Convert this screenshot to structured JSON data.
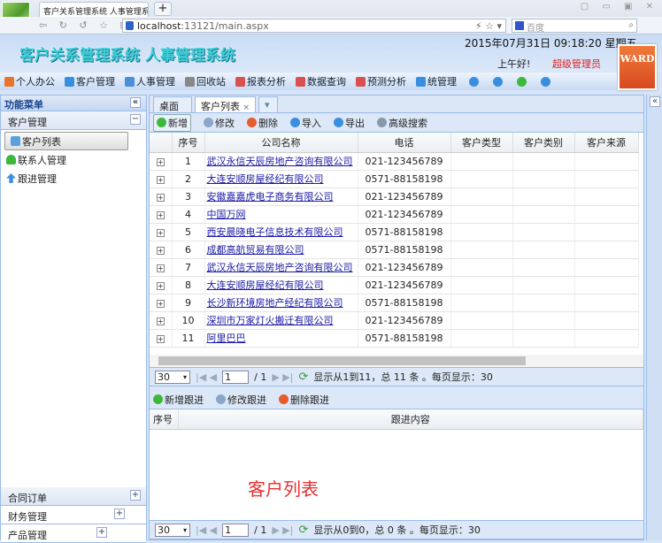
{
  "browser": {
    "tab_title": "客户关系管理系统 人事管理系统",
    "new_tab": "+",
    "url_host": "localhost",
    "url_rest": ":13121/main.aspx",
    "search_placeholder": "百度",
    "window_controls": "▢ ▭ ▣ ✕"
  },
  "header": {
    "title": "客户关系管理系统 人事管理系统",
    "datetime": "2015年07月31日 09:18:20 星期五",
    "greeting": "上午好!",
    "role": "超级管理员",
    "logo_text": "WARD"
  },
  "menu": [
    {
      "label": "个人办公",
      "icon": "home-icon",
      "color": "#e8742a"
    },
    {
      "label": "客户管理",
      "icon": "card-icon",
      "color": "#3a8ee0"
    },
    {
      "label": "人事管理",
      "icon": "user-icon",
      "color": "#4a90d9"
    },
    {
      "label": "回收站",
      "icon": "recycle-icon",
      "color": "#888888"
    },
    {
      "label": "报表分析",
      "icon": "chart-icon",
      "color": "#d85050"
    },
    {
      "label": "数据查询",
      "icon": "chart-icon",
      "color": "#d85050"
    },
    {
      "label": "预测分析",
      "icon": "chart-icon",
      "color": "#d85050"
    },
    {
      "label": "统管理",
      "icon": "gear-icon",
      "color": "#3a8ee0"
    }
  ],
  "sidebar": {
    "title": "功能菜单",
    "collapse": "«",
    "sections": [
      {
        "label": "客户管理",
        "toggle": "−"
      },
      {
        "label": "合同订单",
        "toggle": "+"
      },
      {
        "label": "财务管理",
        "toggle": "+"
      },
      {
        "label": "产品管理",
        "toggle": "+"
      }
    ],
    "items": [
      {
        "label": "客户列表",
        "icon": "home-icon"
      },
      {
        "label": "联系人管理",
        "icon": "contact-icon"
      },
      {
        "label": "跟进管理",
        "icon": "arrow-up-icon"
      }
    ]
  },
  "tabs": [
    {
      "label": "桌面"
    },
    {
      "label": "客户列表",
      "close": "×"
    }
  ],
  "toolbar": [
    "新增",
    "修改",
    "删除",
    "导入",
    "导出",
    "高级搜索"
  ],
  "grid": {
    "columns": [
      "序号",
      "公司名称",
      "电话",
      "客户类型",
      "客户类别",
      "客户来源"
    ],
    "rows": [
      [
        "1",
        "武汉永信天辰房地产咨询有限公司",
        "021-123456789"
      ],
      [
        "2",
        "大连安顺房屋经纪有限公司",
        "0571-88158198"
      ],
      [
        "3",
        "安徽嘉嘉虎电子商务有限公司",
        "021-123456789"
      ],
      [
        "4",
        "中国万网",
        "021-123456789"
      ],
      [
        "5",
        "西安晨晓电子信息技术有限公司",
        "0571-88158198"
      ],
      [
        "6",
        "成都高航贸易有限公司",
        "0571-88158198"
      ],
      [
        "7",
        "武汉永信天辰房地产咨询有限公司",
        "021-123456789"
      ],
      [
        "8",
        "大连安顺房屋经纪有限公司",
        "021-123456789"
      ],
      [
        "9",
        "长沙新环境房地产经纪有限公司",
        "0571-88158198"
      ],
      [
        "10",
        "深圳市万家灯火搬迁有限公司",
        "021-123456789"
      ],
      [
        "11",
        "阿里巴巴",
        "0571-88158198"
      ]
    ]
  },
  "pager": {
    "page_size": "30",
    "page": "1",
    "total_pages": "/ 1",
    "info": "显示从1到11，总 11 条 。每页显示：30"
  },
  "followup": {
    "toolbar": [
      "新增跟进",
      "修改跟进",
      "删除跟进"
    ],
    "columns": [
      "序号",
      "跟进内容"
    ],
    "watermark": "客户列表"
  },
  "pager2": {
    "page_size": "30",
    "page": "1",
    "total_pages": "/ 1",
    "info": "显示从0到0，总 0 条 。每页显示：30"
  }
}
